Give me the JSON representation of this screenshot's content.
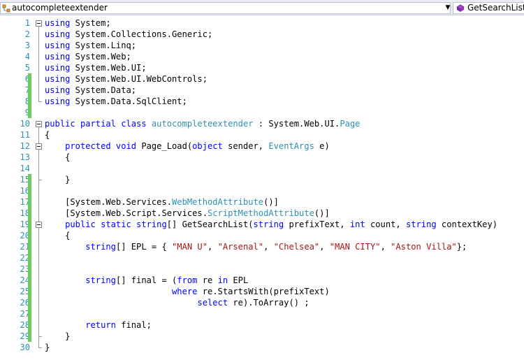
{
  "topbar": {
    "class_selector": "autocompleteextender",
    "member_selector": "GetSearchList(st",
    "dropdown_icon": "chevron-down-icon"
  },
  "colors": {
    "keyword": "#0000ff",
    "type": "#2b91af",
    "string": "#a31515",
    "line_number": "#2b91af",
    "changed_marker": "#6ccb5f",
    "saved_marker": "#ffffff"
  },
  "lines": [
    {
      "n": "1",
      "c": [
        {
          "k": "kw",
          "t": "using"
        },
        {
          "k": "",
          "t": " System;"
        }
      ]
    },
    {
      "n": "2",
      "c": [
        {
          "k": "kw",
          "t": "using"
        },
        {
          "k": "",
          "t": " System.Collections.Generic;"
        }
      ]
    },
    {
      "n": "3",
      "c": [
        {
          "k": "kw",
          "t": "using"
        },
        {
          "k": "",
          "t": " System.Linq;"
        }
      ]
    },
    {
      "n": "4",
      "c": [
        {
          "k": "kw",
          "t": "using"
        },
        {
          "k": "",
          "t": " System.Web;"
        }
      ]
    },
    {
      "n": "5",
      "c": [
        {
          "k": "kw",
          "t": "using"
        },
        {
          "k": "",
          "t": " System.Web.UI;"
        }
      ]
    },
    {
      "n": "6",
      "c": [
        {
          "k": "kw",
          "t": "using"
        },
        {
          "k": "",
          "t": " System.Web.UI.WebControls;"
        }
      ]
    },
    {
      "n": "7",
      "c": [
        {
          "k": "kw",
          "t": "using"
        },
        {
          "k": "",
          "t": " System.Data;"
        }
      ]
    },
    {
      "n": "8",
      "c": [
        {
          "k": "kw",
          "t": "using"
        },
        {
          "k": "",
          "t": " System.Data.SqlClient;"
        }
      ]
    },
    {
      "n": "9",
      "c": []
    },
    {
      "n": "10",
      "c": [
        {
          "k": "kw",
          "t": "public partial class"
        },
        {
          "k": "",
          "t": " "
        },
        {
          "k": "ty",
          "t": "autocompleteextender"
        },
        {
          "k": "",
          "t": " : System.Web.UI."
        },
        {
          "k": "ty",
          "t": "Page"
        }
      ]
    },
    {
      "n": "11",
      "c": [
        {
          "k": "",
          "t": "{"
        }
      ]
    },
    {
      "n": "12",
      "c": [
        {
          "k": "",
          "t": "    "
        },
        {
          "k": "kw",
          "t": "protected void"
        },
        {
          "k": "",
          "t": " Page_Load("
        },
        {
          "k": "kw",
          "t": "object"
        },
        {
          "k": "",
          "t": " sender, "
        },
        {
          "k": "ty",
          "t": "EventArgs"
        },
        {
          "k": "",
          "t": " e)"
        }
      ]
    },
    {
      "n": "13",
      "c": [
        {
          "k": "",
          "t": "    {"
        }
      ]
    },
    {
      "n": "14",
      "c": []
    },
    {
      "n": "15",
      "c": [
        {
          "k": "",
          "t": "    }"
        }
      ]
    },
    {
      "n": "16",
      "c": []
    },
    {
      "n": "17",
      "c": [
        {
          "k": "",
          "t": "    [System.Web.Services."
        },
        {
          "k": "ty",
          "t": "WebMethodAttribute"
        },
        {
          "k": "",
          "t": "()]"
        }
      ]
    },
    {
      "n": "18",
      "c": [
        {
          "k": "",
          "t": "    [System.Web.Script.Services."
        },
        {
          "k": "ty",
          "t": "ScriptMethodAttribute"
        },
        {
          "k": "",
          "t": "()]"
        }
      ]
    },
    {
      "n": "19",
      "c": [
        {
          "k": "",
          "t": "    "
        },
        {
          "k": "kw",
          "t": "public static string"
        },
        {
          "k": "",
          "t": "[] GetSearchList("
        },
        {
          "k": "kw",
          "t": "string"
        },
        {
          "k": "",
          "t": " prefixText, "
        },
        {
          "k": "kw",
          "t": "int"
        },
        {
          "k": "",
          "t": " count, "
        },
        {
          "k": "kw",
          "t": "string"
        },
        {
          "k": "",
          "t": " contextKey)"
        }
      ]
    },
    {
      "n": "20",
      "c": [
        {
          "k": "",
          "t": "    {"
        }
      ]
    },
    {
      "n": "21",
      "c": [
        {
          "k": "",
          "t": "        "
        },
        {
          "k": "kw",
          "t": "string"
        },
        {
          "k": "",
          "t": "[] EPL = { "
        },
        {
          "k": "str",
          "t": "\"MAN U\""
        },
        {
          "k": "",
          "t": ", "
        },
        {
          "k": "str",
          "t": "\"Arsenal\""
        },
        {
          "k": "",
          "t": ", "
        },
        {
          "k": "str",
          "t": "\"Chelsea\""
        },
        {
          "k": "",
          "t": ", "
        },
        {
          "k": "str",
          "t": "\"MAN CITY\""
        },
        {
          "k": "",
          "t": ", "
        },
        {
          "k": "str",
          "t": "\"Aston Villa\""
        },
        {
          "k": "",
          "t": "};"
        }
      ]
    },
    {
      "n": "22",
      "c": []
    },
    {
      "n": "23",
      "c": []
    },
    {
      "n": "24",
      "c": [
        {
          "k": "",
          "t": "        "
        },
        {
          "k": "kw",
          "t": "string"
        },
        {
          "k": "",
          "t": "[] final = ("
        },
        {
          "k": "kw",
          "t": "from"
        },
        {
          "k": "",
          "t": " re "
        },
        {
          "k": "kw",
          "t": "in"
        },
        {
          "k": "",
          "t": " EPL"
        }
      ]
    },
    {
      "n": "25",
      "c": [
        {
          "k": "",
          "t": "                         "
        },
        {
          "k": "kw",
          "t": "where"
        },
        {
          "k": "",
          "t": " re.StartsWith(prefixText)"
        }
      ]
    },
    {
      "n": "26",
      "c": [
        {
          "k": "",
          "t": "                              "
        },
        {
          "k": "kw",
          "t": "select"
        },
        {
          "k": "",
          "t": " re).ToArray() ;"
        }
      ]
    },
    {
      "n": "27",
      "c": []
    },
    {
      "n": "28",
      "c": [
        {
          "k": "",
          "t": "        "
        },
        {
          "k": "kw",
          "t": "return"
        },
        {
          "k": "",
          "t": " final;"
        }
      ]
    },
    {
      "n": "29",
      "c": [
        {
          "k": "",
          "t": "    }"
        }
      ]
    },
    {
      "n": "30",
      "c": [
        {
          "k": "",
          "t": "}"
        }
      ]
    }
  ]
}
